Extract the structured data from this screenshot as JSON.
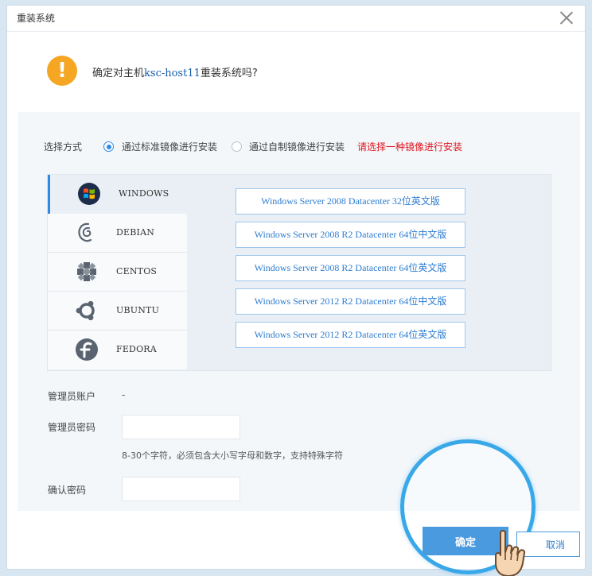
{
  "dialog": {
    "title": "重装系统",
    "confirm_prefix": "确定对主机",
    "host_name": "ksc-host11",
    "confirm_suffix": "重装系统吗?",
    "warning_glyph": "!",
    "accent_color": "#2e8ae6",
    "warning_color": "#f5a623"
  },
  "select_method": {
    "label": "选择方式",
    "options": [
      {
        "label": "通过标准镜像进行安装",
        "checked": true
      },
      {
        "label": "通过自制镜像进行安装",
        "checked": false
      }
    ],
    "hint": "请选择一种镜像进行安装",
    "hint_color": "#e0141e"
  },
  "os_list": [
    {
      "name": "WINDOWS",
      "icon": "windows-icon",
      "active": true
    },
    {
      "name": "DEBIAN",
      "icon": "debian-icon",
      "active": false
    },
    {
      "name": "CENTOS",
      "icon": "centos-icon",
      "active": false
    },
    {
      "name": "UBUNTU",
      "icon": "ubuntu-icon",
      "active": false
    },
    {
      "name": "FEDORA",
      "icon": "fedora-icon",
      "active": false
    }
  ],
  "versions": [
    "Windows Server 2008 Datacenter 32位英文版",
    "Windows Server 2008 R2 Datacenter 64位中文版",
    "Windows Server 2008 R2 Datacenter 64位英文版",
    "Windows Server 2012 R2 Datacenter 64位中文版",
    "Windows Server 2012 R2 Datacenter 64位英文版"
  ],
  "admin_account": {
    "label": "管理员账户",
    "value": "-"
  },
  "admin_password": {
    "label": "管理员密码",
    "value": "",
    "hint": "8-30个字符，必须包含大小写字母和数字，支持特殊字符"
  },
  "confirm_password": {
    "label": "确认密码",
    "value": ""
  },
  "buttons": {
    "ok": "确定",
    "cancel": "取消"
  }
}
